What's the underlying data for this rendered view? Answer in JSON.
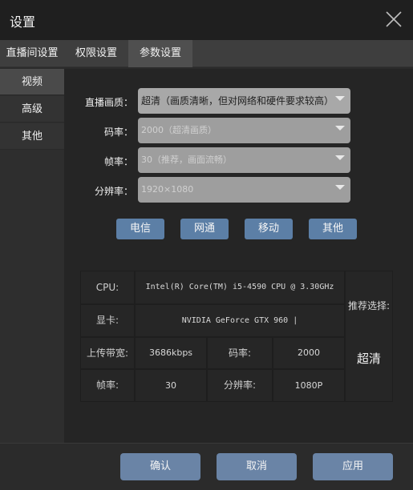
{
  "window": {
    "title": "设置"
  },
  "tabs": [
    {
      "label": "直播间设置"
    },
    {
      "label": "权限设置"
    },
    {
      "label": "参数设置"
    }
  ],
  "sidebar": {
    "items": [
      {
        "label": "视频"
      },
      {
        "label": "高级"
      },
      {
        "label": "其他"
      }
    ]
  },
  "video": {
    "quality": {
      "label": "直播画质：",
      "value": "超清（画质清晰，但对网络和硬件要求较高）"
    },
    "bitrate": {
      "label": "码率：",
      "value": "2000（超清画质）"
    },
    "framerate": {
      "label": "帧率：",
      "value": "30（推荐，画面流畅）"
    },
    "resolution": {
      "label": "分辨率：",
      "value": "1920×1080"
    }
  },
  "isp_buttons": [
    {
      "label": "电信"
    },
    {
      "label": "网通"
    },
    {
      "label": "移动"
    },
    {
      "label": "其他"
    }
  ],
  "info": {
    "cpu_label": "CPU:",
    "cpu_value": "Intel(R) Core(TM) i5-4590 CPU @ 3.30GHz",
    "gpu_label": "显卡:",
    "gpu_value": "NVIDIA GeForce GTX 960 |",
    "upload_label": "上传带宽:",
    "upload_value": "3686kbps",
    "bitrate_label": "码率:",
    "bitrate_value": "2000",
    "fps_label": "帧率:",
    "fps_value": "30",
    "res_label": "分辨率:",
    "res_value": "1080P",
    "recommend_label": "推荐选择:",
    "recommend_value": "超清"
  },
  "footer": {
    "confirm": "确认",
    "cancel": "取消",
    "apply": "应用"
  },
  "colors": {
    "accent_button": "#6a84a6",
    "isp_button": "#5c7fa6"
  }
}
